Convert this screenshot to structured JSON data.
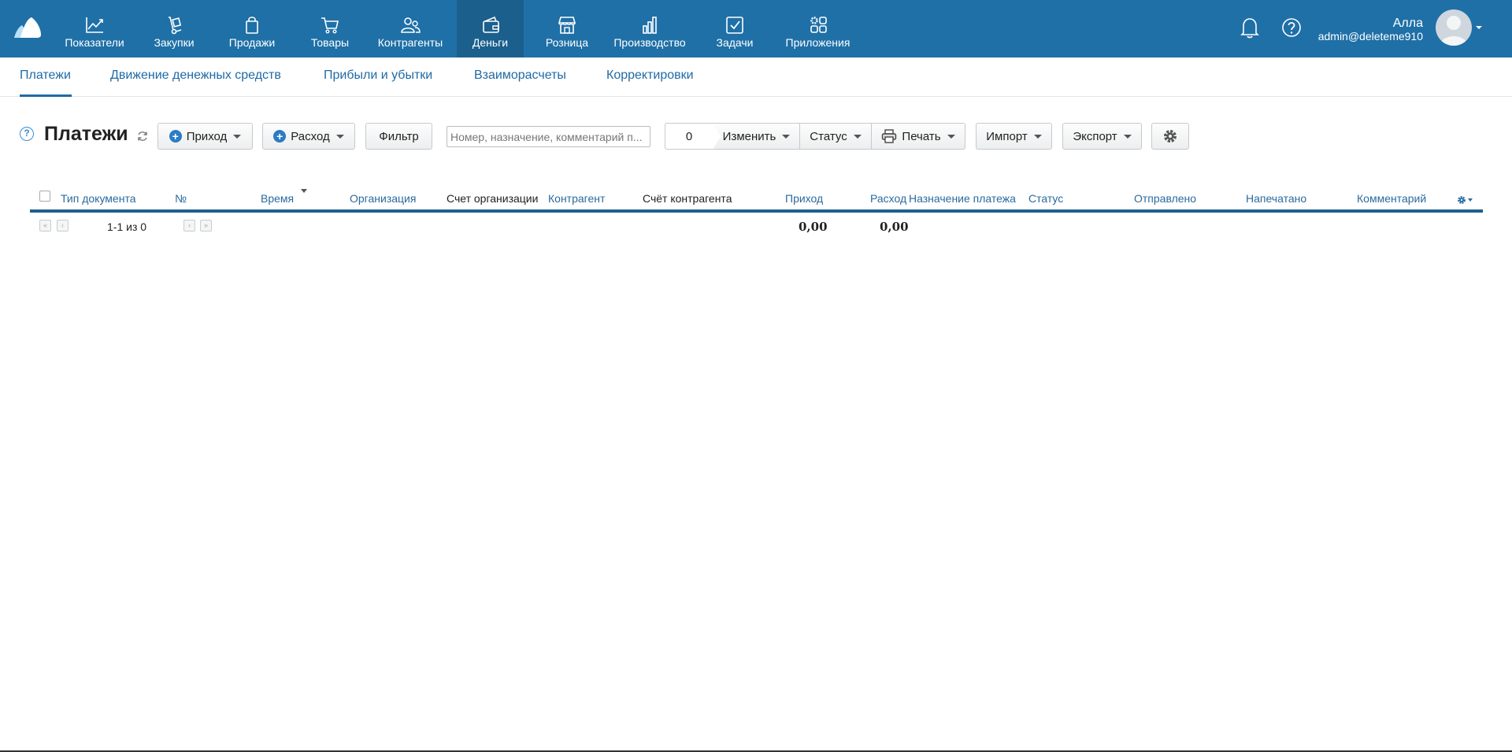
{
  "nav": {
    "items": [
      {
        "label": "Показатели",
        "icon": "chart-line-icon"
      },
      {
        "label": "Закупки",
        "icon": "hand-truck-icon"
      },
      {
        "label": "Продажи",
        "icon": "shopping-bag-icon"
      },
      {
        "label": "Товары",
        "icon": "cart-icon"
      },
      {
        "label": "Контрагенты",
        "icon": "people-icon"
      },
      {
        "label": "Деньги",
        "icon": "wallet-icon",
        "active": true
      },
      {
        "label": "Розница",
        "icon": "store-icon"
      },
      {
        "label": "Производство",
        "icon": "bar-chart-icon"
      },
      {
        "label": "Задачи",
        "icon": "checkbox-icon"
      },
      {
        "label": "Приложения",
        "icon": "apps-icon"
      }
    ],
    "user_name": "Алла",
    "user_login": "admin@deleteme910"
  },
  "subnav": {
    "items": [
      {
        "label": "Платежи",
        "active": true
      },
      {
        "label": "Движение денежных средств"
      },
      {
        "label": "Прибыли и убытки"
      },
      {
        "label": "Взаиморасчеты"
      },
      {
        "label": "Корректировки"
      }
    ]
  },
  "toolbar": {
    "help": "?",
    "title": "Платежи",
    "income_label": "Приход",
    "expense_label": "Расход",
    "filter_label": "Фильтр",
    "search_placeholder": "Номер, назначение, комментарий п...",
    "selected_count": "0",
    "change_label": "Изменить",
    "status_label": "Статус",
    "print_label": "Печать",
    "import_label": "Импорт",
    "export_label": "Экспорт"
  },
  "table": {
    "columns": [
      "Тип документа",
      "№",
      "Время",
      "Организация",
      "Счет организации",
      "Контрагент",
      "Счёт контрагента",
      "Приход",
      "Расход",
      "Назначение платежа",
      "Статус",
      "Отправлено",
      "Напечатано",
      "Комментарий"
    ],
    "pager_text": "1-1 из 0",
    "total_income": "0,00",
    "total_expense": "0,00"
  },
  "colors": {
    "topbar": "#1f70a7",
    "topbar_active": "#1b5f8d",
    "link": "#1f6aa5",
    "table_rule": "#1f5f8f"
  }
}
